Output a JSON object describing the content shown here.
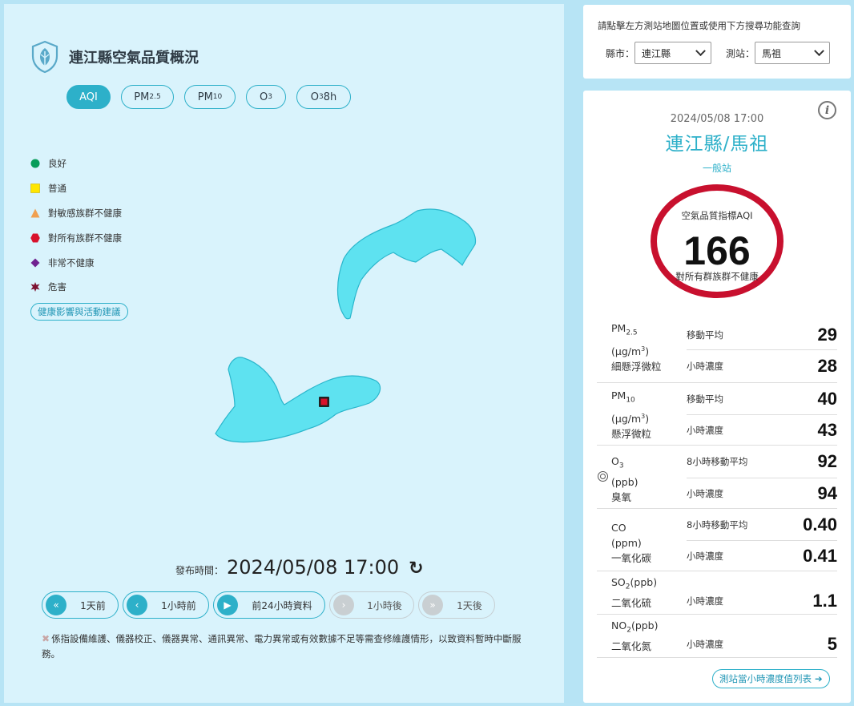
{
  "header": {
    "title": "連江縣空氣品質概況"
  },
  "tabs": [
    {
      "main": "AQI",
      "sub": ""
    },
    {
      "main": "PM",
      "sub": "2.5"
    },
    {
      "main": "PM",
      "sub": "10"
    },
    {
      "main": "O",
      "sub": "3"
    },
    {
      "main": "O",
      "sub": "3",
      "suffix": " 8h"
    }
  ],
  "legend": [
    {
      "label": "良好",
      "color": "#079d5a",
      "shape": "circle"
    },
    {
      "label": "普通",
      "color": "#ffe600",
      "shape": "square"
    },
    {
      "label": "對敏感族群不健康",
      "color": "#f0a050",
      "shape": "triangle"
    },
    {
      "label": "對所有族群不健康",
      "color": "#d8122c",
      "shape": "hexagon"
    },
    {
      "label": "非常不健康",
      "color": "#702290",
      "shape": "diamond"
    },
    {
      "label": "危害",
      "color": "#7c1130",
      "shape": "star"
    }
  ],
  "health_link": "健康影響與活動建議",
  "publish": {
    "label": "發布時間：",
    "time": "2024/05/08 17:00",
    "refresh_icon": "refresh-icon"
  },
  "time_nav": [
    {
      "icon": "«",
      "label": "1天前",
      "enabled": true
    },
    {
      "icon": "‹",
      "label": "1小時前",
      "enabled": true
    },
    {
      "icon": "▶",
      "label": "前24小時資料",
      "enabled": true
    },
    {
      "icon": "›",
      "label": "1小時後",
      "enabled": false
    },
    {
      "icon": "»",
      "label": "1天後",
      "enabled": false
    }
  ],
  "notice": "係指設備維護、儀器校正、儀器異常、通訊異常、電力異常或有效數據不足等需查修維護情形，以致資料暫時中斷服務。",
  "search": {
    "hint": "請點擊左方測站地圖位置或使用下方搜尋功能查詢",
    "county_label": "縣市：",
    "county_value": "連江縣",
    "station_label": "測站：",
    "station_value": "馬祖"
  },
  "station": {
    "datetime": "2024/05/08 17:00",
    "name": "連江縣/馬祖",
    "type": "一般站",
    "aqi_label": "空氣品質指標AQI",
    "aqi_value": "166",
    "aqi_status": "對所有群族群不健康",
    "aqi_color": "#c8102e"
  },
  "pollutants": [
    {
      "name": "PM",
      "sub": "2.5",
      "unit": "(μg/m",
      "unit_sup": "3",
      "unit_end": ")",
      "desc": "細懸浮微粒",
      "target": false,
      "rows": [
        {
          "label": "移動平均",
          "value": "29"
        },
        {
          "label": "小時濃度",
          "value": "28"
        }
      ]
    },
    {
      "name": "PM",
      "sub": "10",
      "unit": "(μg/m",
      "unit_sup": "3",
      "unit_end": ")",
      "desc": "懸浮微粒",
      "target": false,
      "rows": [
        {
          "label": "移動平均",
          "value": "40"
        },
        {
          "label": "小時濃度",
          "value": "43"
        }
      ]
    },
    {
      "name": "O",
      "sub": "3",
      "unit": "(ppb)",
      "unit_sup": "",
      "unit_end": "",
      "desc": "臭氧",
      "target": true,
      "rows": [
        {
          "label": "8小時移動平均",
          "value": "92"
        },
        {
          "label": "小時濃度",
          "value": "94"
        }
      ]
    },
    {
      "name": "CO",
      "sub": "",
      "unit": "(ppm)",
      "unit_sup": "",
      "unit_end": "",
      "desc": "一氧化碳",
      "target": false,
      "rows": [
        {
          "label": "8小時移動平均",
          "value": "0.40"
        },
        {
          "label": "小時濃度",
          "value": "0.41"
        }
      ]
    },
    {
      "name": "SO",
      "sub": "2",
      "unit": "(ppb)",
      "unit_sup": "",
      "unit_end": "",
      "desc": "二氧化硫",
      "target": false,
      "inline_unit": true,
      "rows": [
        {
          "label": "小時濃度",
          "value": "1.1"
        }
      ]
    },
    {
      "name": "NO",
      "sub": "2",
      "unit": "(ppb)",
      "unit_sup": "",
      "unit_end": "",
      "desc": "二氧化氮",
      "target": false,
      "inline_unit": true,
      "rows": [
        {
          "label": "小時濃度",
          "value": "5"
        }
      ]
    }
  ],
  "list_link": "測站當小時濃度值列表",
  "colors": {
    "accent": "#2db0c9",
    "island_fill": "#5ee2f0",
    "island_stroke": "#2ab6cc",
    "marker": "#d8122c"
  }
}
